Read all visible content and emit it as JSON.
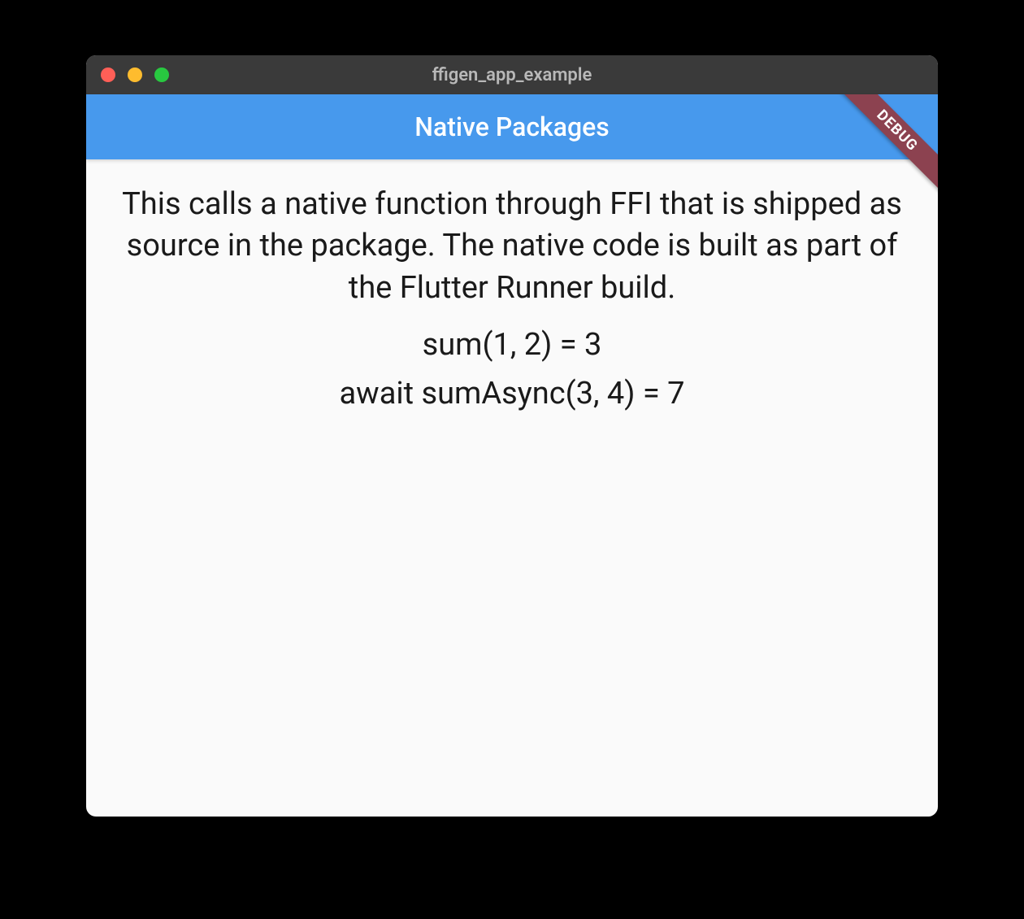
{
  "window": {
    "title": "ffigen_app_example"
  },
  "appBar": {
    "title": "Native Packages"
  },
  "debugBanner": {
    "label": "DEBUG"
  },
  "content": {
    "description": "This calls a native function through FFI that is shipped as source in the package. The native code is built as part of the Flutter Runner build.",
    "sumResult": "sum(1, 2) = 3",
    "sumAsyncResult": "await sumAsync(3, 4) = 7"
  },
  "colors": {
    "appBarBackground": "#4799ed",
    "debugBannerBackground": "#8c4250",
    "titlebarBackground": "#3a3a3a"
  }
}
